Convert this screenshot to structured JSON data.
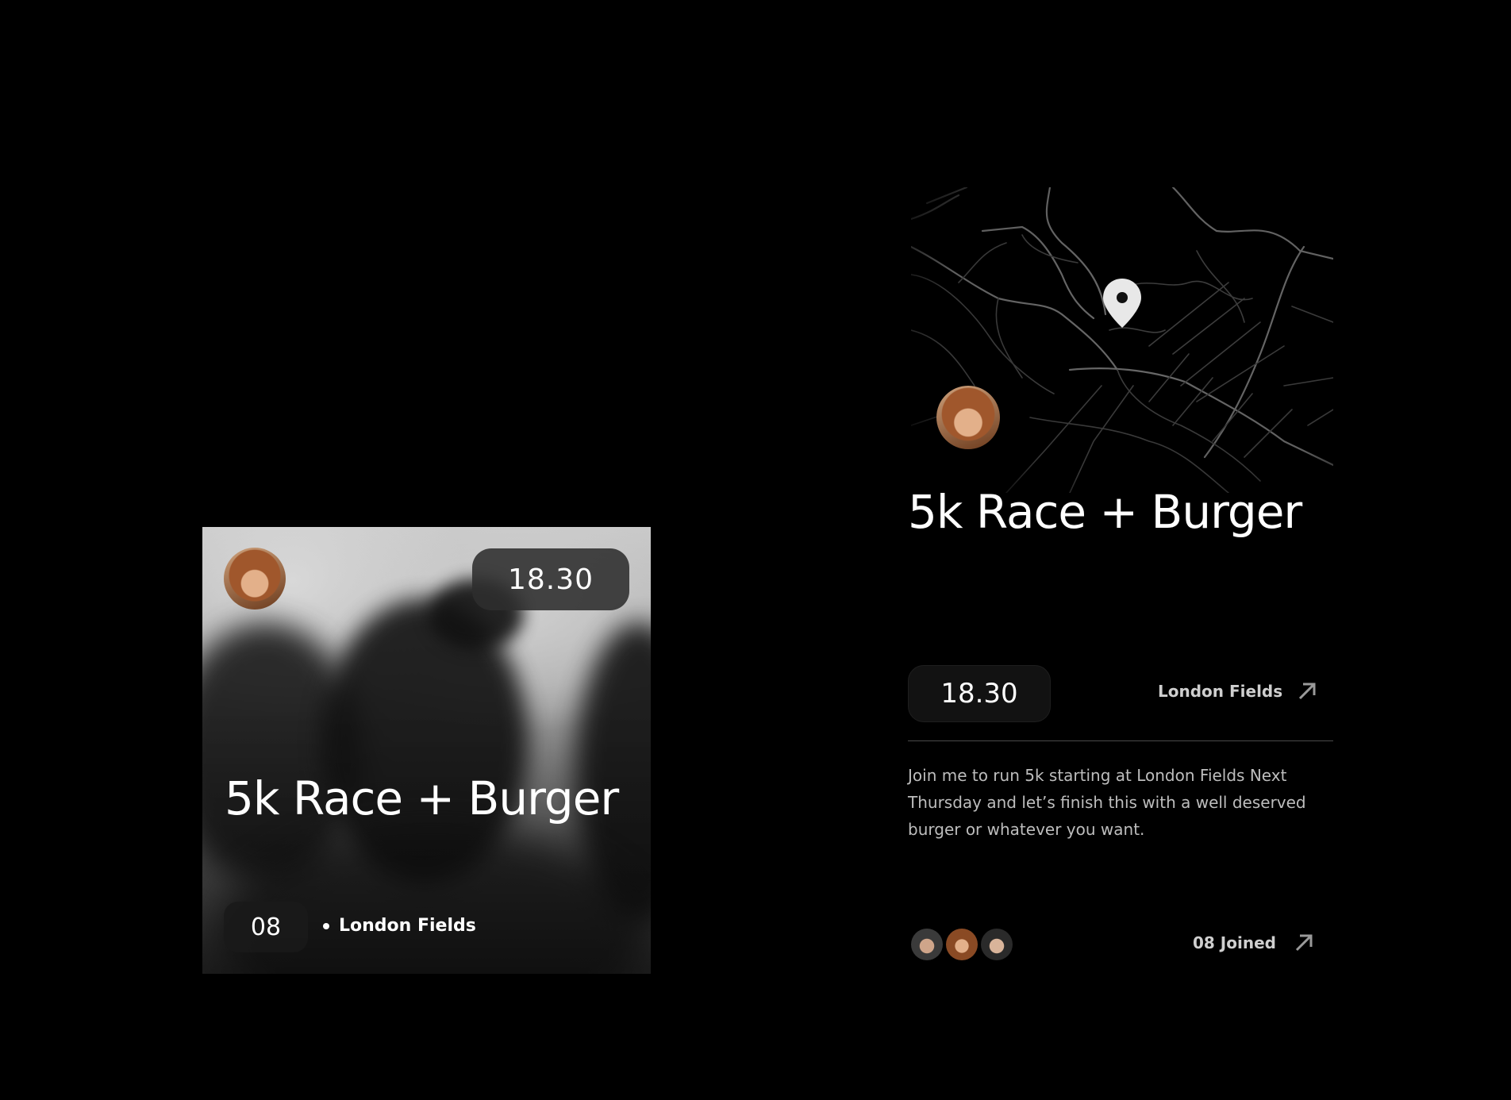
{
  "card": {
    "time": "18.30",
    "title": "5k Race + Burger",
    "count": "08",
    "location": "London Fields"
  },
  "detail": {
    "title": "5k Race + Burger",
    "time": "18.30",
    "location": "London Fields",
    "description": "Join me to run 5k starting at London Fields Next Thursday and let’s finish this with a well deserved burger or whatever you want.",
    "joined_label": "08 Joined"
  },
  "icons": {
    "location_pin": "map-pin-icon",
    "arrow": "arrow-up-right-icon"
  },
  "colors": {
    "background": "#000000",
    "text": "#ffffff",
    "muted_text": "#bdbdbd"
  }
}
